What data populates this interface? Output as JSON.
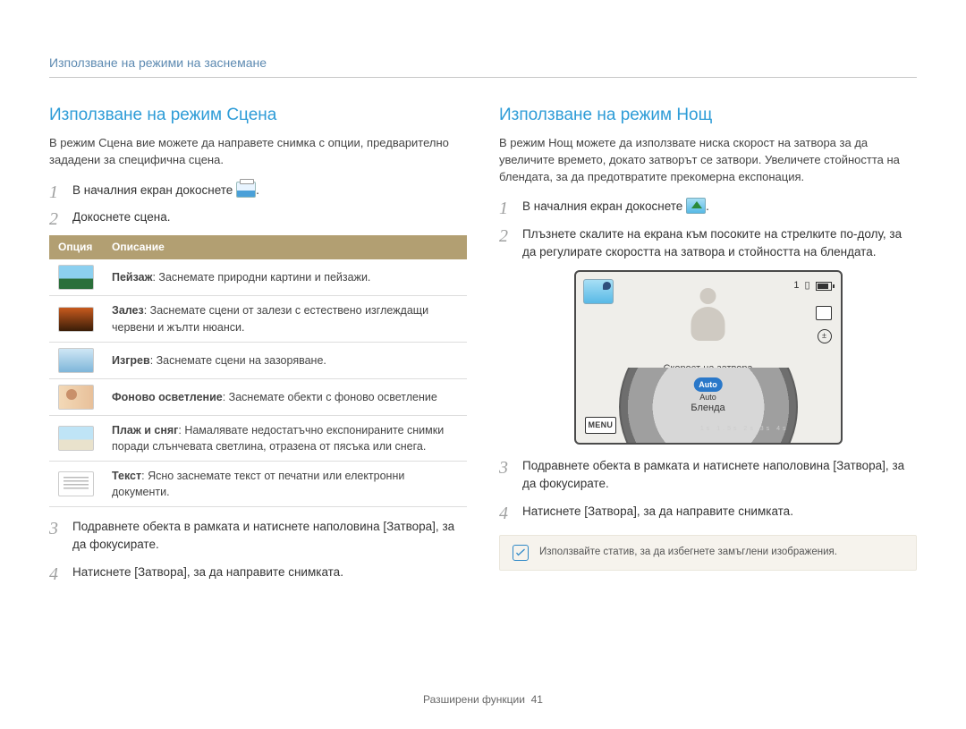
{
  "breadcrumb": "Използване на режими на заснемане",
  "left": {
    "heading": "Използване на режим Сцена",
    "intro": "В режим Сцена вие можете да направете снимка с опции, предварително зададени за специфична сцена.",
    "step1_pre": "В началния екран докоснете",
    "step1_post": ".",
    "step2": "Докоснете сцена.",
    "table": {
      "header_option": "Опция",
      "header_desc": "Описание",
      "rows": [
        {
          "name": "Пейзаж",
          "desc": ": Заснемате природни картини и пейзажи."
        },
        {
          "name": "Залез",
          "desc": ": Заснемате сцени от залези с естествено изглеждащи червени и жълти нюанси."
        },
        {
          "name": "Изгрев",
          "desc": ": Заснемате сцени на зазоряване."
        },
        {
          "name": "Фоново осветление",
          "desc": ": Заснемате обекти с фоново осветление"
        },
        {
          "name": "Плаж и сняг",
          "desc": ": Намалявате недостатъчно експонираните снимки поради слънчевата светлина, отразена от пясъка или снега."
        },
        {
          "name": "Текст",
          "desc": ": Ясно заснемате текст от печатни или електронни документи."
        }
      ]
    },
    "step3": "Подравнете обекта в рамката и натиснете наполовина [Затвора], за да фокусирате.",
    "step4": "Натиснете [Затвора], за да направите снимката."
  },
  "right": {
    "heading": "Използване на режим Нощ",
    "intro": "В режим Нощ можете да използвате ниска скорост на затвора за да увеличите времето, докато затворът се затвори. Увеличете стойността на блендата, за да предотвратите прекомерна експонация.",
    "step1_pre": "В началния екран докоснете",
    "step1_post": ".",
    "step2": "Плъзнете скалите на екрана към посоките на стрелките по-долу, за да регулирате скоростта на затвора и стойността на блендата.",
    "screen": {
      "count": "1",
      "framing_icon": "▯",
      "menu": "MENU",
      "shutter_label": "Скорост на затвора",
      "auto_chip": "Auto",
      "auto_text": "Auto",
      "aperture_label": "Бленда",
      "ticks": "1s  1.5s  2s  3s  4s"
    },
    "step3": "Подравнете обекта в рамката и натиснете наполовина [Затвора], за да фокусирате.",
    "step4": "Натиснете [Затвора], за да направите снимката.",
    "note": "Използвайте статив, за да избегнете замъглени изображения."
  },
  "footer_label": "Разширени функции",
  "footer_page": "41"
}
